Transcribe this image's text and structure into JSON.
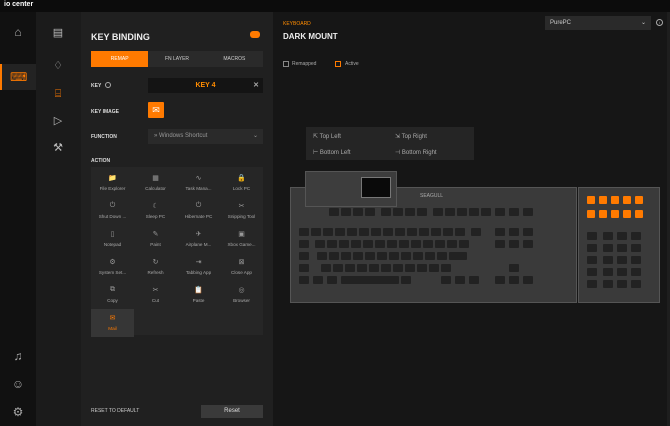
{
  "app": {
    "logo": "io center"
  },
  "panel": {
    "title": "KEY BINDING",
    "tabs": [
      "REMAP",
      "FN LAYER",
      "MACROS"
    ],
    "key_label": "KEY",
    "key_value": "KEY 4",
    "key_image_label": "KEY IMAGE",
    "function_label": "FUNCTION",
    "function_value": "Windows Shortcut",
    "action_label": "ACTION",
    "actions": [
      "File Explorer",
      "Calculator",
      "Task Mana...",
      "Lock PC",
      "Shut Down ...",
      "Sleep PC",
      "Hibernate PC",
      "Snipping Tool",
      "Notepad",
      "Paint",
      "Airplane M...",
      "Xbox Game...",
      "System Set...",
      "Refresh",
      "Tabbing App",
      "Close App",
      "Copy",
      "Cut",
      "Paste",
      "Browser",
      "Mail"
    ],
    "action_icons": [
      "📁",
      "▦",
      "∿",
      "🔒",
      "⏻",
      "☾",
      "⏻",
      "✂",
      "▯",
      "✎",
      "✈",
      "▣",
      "⚙",
      "↻",
      "⇥",
      "⊠",
      "⧉",
      "✂",
      "📋",
      "◎",
      "✉"
    ],
    "selected_action": 20,
    "reset_label": "RESET TO DEFAULT",
    "reset_button": "Reset"
  },
  "main": {
    "section": "KEYBOARD",
    "device_name": "DARK MOUNT",
    "selector": "PurePC",
    "remapped": "Remapped",
    "active": "Active",
    "positions": [
      "Top Left",
      "Top Right",
      "Bottom Left",
      "Bottom Right"
    ],
    "brand": "SEAGULL"
  },
  "colors": {
    "accent": "#ff7a00"
  }
}
